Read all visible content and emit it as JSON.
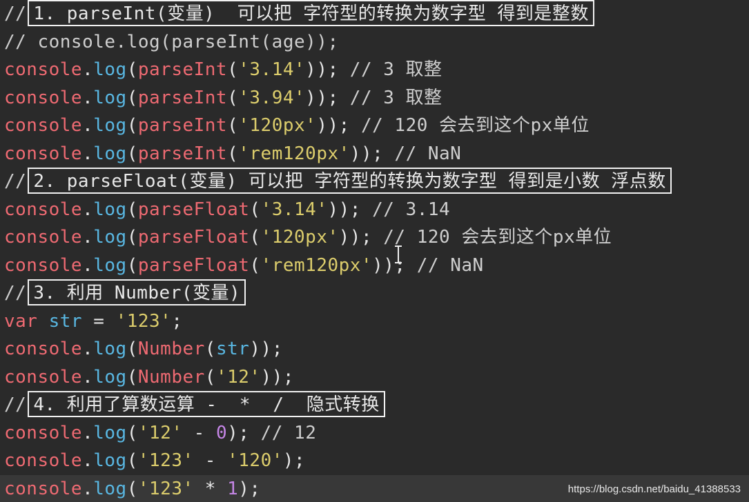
{
  "editor": {
    "lines": [
      {
        "tokens": [
          {
            "t": "comment",
            "v": "//"
          },
          {
            "t": "boxed",
            "v": "1. parseInt(变量)  可以把 字符型的转换为数字型 得到是整数"
          }
        ]
      },
      {
        "tokens": [
          {
            "t": "comment",
            "v": "// console.log(parseInt(age));"
          }
        ]
      },
      {
        "tokens": [
          {
            "t": "obj",
            "v": "console"
          },
          {
            "t": "plain",
            "v": "."
          },
          {
            "t": "method",
            "v": "log"
          },
          {
            "t": "paren",
            "v": "("
          },
          {
            "t": "func",
            "v": "parseInt"
          },
          {
            "t": "paren",
            "v": "("
          },
          {
            "t": "string",
            "v": "'3.14'"
          },
          {
            "t": "paren",
            "v": "));"
          },
          {
            "t": "comment",
            "v": " // 3 取整"
          }
        ]
      },
      {
        "tokens": [
          {
            "t": "obj",
            "v": "console"
          },
          {
            "t": "plain",
            "v": "."
          },
          {
            "t": "method",
            "v": "log"
          },
          {
            "t": "paren",
            "v": "("
          },
          {
            "t": "func",
            "v": "parseInt"
          },
          {
            "t": "paren",
            "v": "("
          },
          {
            "t": "string",
            "v": "'3.94'"
          },
          {
            "t": "paren",
            "v": "));"
          },
          {
            "t": "comment",
            "v": " // 3 取整"
          }
        ]
      },
      {
        "tokens": [
          {
            "t": "obj",
            "v": "console"
          },
          {
            "t": "plain",
            "v": "."
          },
          {
            "t": "method",
            "v": "log"
          },
          {
            "t": "paren",
            "v": "("
          },
          {
            "t": "func",
            "v": "parseInt"
          },
          {
            "t": "paren",
            "v": "("
          },
          {
            "t": "string",
            "v": "'120px'"
          },
          {
            "t": "paren",
            "v": "));"
          },
          {
            "t": "comment",
            "v": " // 120 会去到这个px单位"
          }
        ]
      },
      {
        "tokens": [
          {
            "t": "obj",
            "v": "console"
          },
          {
            "t": "plain",
            "v": "."
          },
          {
            "t": "method",
            "v": "log"
          },
          {
            "t": "paren",
            "v": "("
          },
          {
            "t": "func",
            "v": "parseInt"
          },
          {
            "t": "paren",
            "v": "("
          },
          {
            "t": "string",
            "v": "'rem120px'"
          },
          {
            "t": "paren",
            "v": "));"
          },
          {
            "t": "comment",
            "v": " // NaN"
          }
        ]
      },
      {
        "tokens": [
          {
            "t": "comment",
            "v": "//"
          },
          {
            "t": "boxed",
            "v": "2. parseFloat(变量) 可以把 字符型的转换为数字型 得到是小数 浮点数"
          }
        ]
      },
      {
        "tokens": [
          {
            "t": "obj",
            "v": "console"
          },
          {
            "t": "plain",
            "v": "."
          },
          {
            "t": "method",
            "v": "log"
          },
          {
            "t": "paren",
            "v": "("
          },
          {
            "t": "func",
            "v": "parseFloat"
          },
          {
            "t": "paren",
            "v": "("
          },
          {
            "t": "string",
            "v": "'3.14'"
          },
          {
            "t": "paren",
            "v": "));"
          },
          {
            "t": "comment",
            "v": " // 3.14"
          }
        ]
      },
      {
        "tokens": [
          {
            "t": "obj",
            "v": "console"
          },
          {
            "t": "plain",
            "v": "."
          },
          {
            "t": "method",
            "v": "log"
          },
          {
            "t": "paren",
            "v": "("
          },
          {
            "t": "func",
            "v": "parseFloat"
          },
          {
            "t": "paren",
            "v": "("
          },
          {
            "t": "string",
            "v": "'120px'"
          },
          {
            "t": "paren",
            "v": "));"
          },
          {
            "t": "comment",
            "v": " // 120 会去到这个px单位"
          }
        ]
      },
      {
        "tokens": [
          {
            "t": "obj",
            "v": "console"
          },
          {
            "t": "plain",
            "v": "."
          },
          {
            "t": "method",
            "v": "log"
          },
          {
            "t": "paren",
            "v": "("
          },
          {
            "t": "func",
            "v": "parseFloat"
          },
          {
            "t": "paren",
            "v": "("
          },
          {
            "t": "string",
            "v": "'rem120px'"
          },
          {
            "t": "paren",
            "v": "));"
          },
          {
            "t": "comment",
            "v": " // NaN"
          }
        ]
      },
      {
        "tokens": [
          {
            "t": "comment",
            "v": "//"
          },
          {
            "t": "boxed",
            "v": "3. 利用 Number(变量)"
          }
        ]
      },
      {
        "tokens": [
          {
            "t": "keyword",
            "v": "var"
          },
          {
            "t": "plain",
            "v": " "
          },
          {
            "t": "ident",
            "v": "str"
          },
          {
            "t": "op",
            "v": " = "
          },
          {
            "t": "string",
            "v": "'123'"
          },
          {
            "t": "plain",
            "v": ";"
          }
        ]
      },
      {
        "tokens": [
          {
            "t": "obj",
            "v": "console"
          },
          {
            "t": "plain",
            "v": "."
          },
          {
            "t": "method",
            "v": "log"
          },
          {
            "t": "paren",
            "v": "("
          },
          {
            "t": "func",
            "v": "Number"
          },
          {
            "t": "paren",
            "v": "("
          },
          {
            "t": "ident",
            "v": "str"
          },
          {
            "t": "paren",
            "v": "));"
          }
        ]
      },
      {
        "tokens": [
          {
            "t": "obj",
            "v": "console"
          },
          {
            "t": "plain",
            "v": "."
          },
          {
            "t": "method",
            "v": "log"
          },
          {
            "t": "paren",
            "v": "("
          },
          {
            "t": "func",
            "v": "Number"
          },
          {
            "t": "paren",
            "v": "("
          },
          {
            "t": "string",
            "v": "'12'"
          },
          {
            "t": "paren",
            "v": "));"
          }
        ]
      },
      {
        "tokens": [
          {
            "t": "comment",
            "v": "//"
          },
          {
            "t": "boxed",
            "v": "4. 利用了算数运算 -  *  /  隐式转换"
          }
        ]
      },
      {
        "tokens": [
          {
            "t": "obj",
            "v": "console"
          },
          {
            "t": "plain",
            "v": "."
          },
          {
            "t": "method",
            "v": "log"
          },
          {
            "t": "paren",
            "v": "("
          },
          {
            "t": "string",
            "v": "'12'"
          },
          {
            "t": "op",
            "v": " - "
          },
          {
            "t": "number",
            "v": "0"
          },
          {
            "t": "paren",
            "v": ");"
          },
          {
            "t": "comment",
            "v": " // 12"
          }
        ]
      },
      {
        "tokens": [
          {
            "t": "obj",
            "v": "console"
          },
          {
            "t": "plain",
            "v": "."
          },
          {
            "t": "method",
            "v": "log"
          },
          {
            "t": "paren",
            "v": "("
          },
          {
            "t": "string",
            "v": "'123'"
          },
          {
            "t": "op",
            "v": " - "
          },
          {
            "t": "string",
            "v": "'120'"
          },
          {
            "t": "paren",
            "v": ");"
          }
        ]
      },
      {
        "tokens": [
          {
            "t": "obj",
            "v": "console"
          },
          {
            "t": "plain",
            "v": "."
          },
          {
            "t": "method",
            "v": "log"
          },
          {
            "t": "paren",
            "v": "("
          },
          {
            "t": "string",
            "v": "'123'"
          },
          {
            "t": "op",
            "v": " * "
          },
          {
            "t": "number",
            "v": "1"
          },
          {
            "t": "paren",
            "v": ");"
          }
        ],
        "current": true
      }
    ],
    "cursor_icon": "text-cursor-icon"
  },
  "watermark": "https://blog.csdn.net/baidu_41388533",
  "colors": {
    "background": "#2a2a2a",
    "current_line": "#383838",
    "comment": "#cfcfcf",
    "object": "#ee6a72",
    "method": "#59b7e2",
    "string": "#dccd6c",
    "number": "#c586e6",
    "box_border": "#f2f2f2"
  }
}
